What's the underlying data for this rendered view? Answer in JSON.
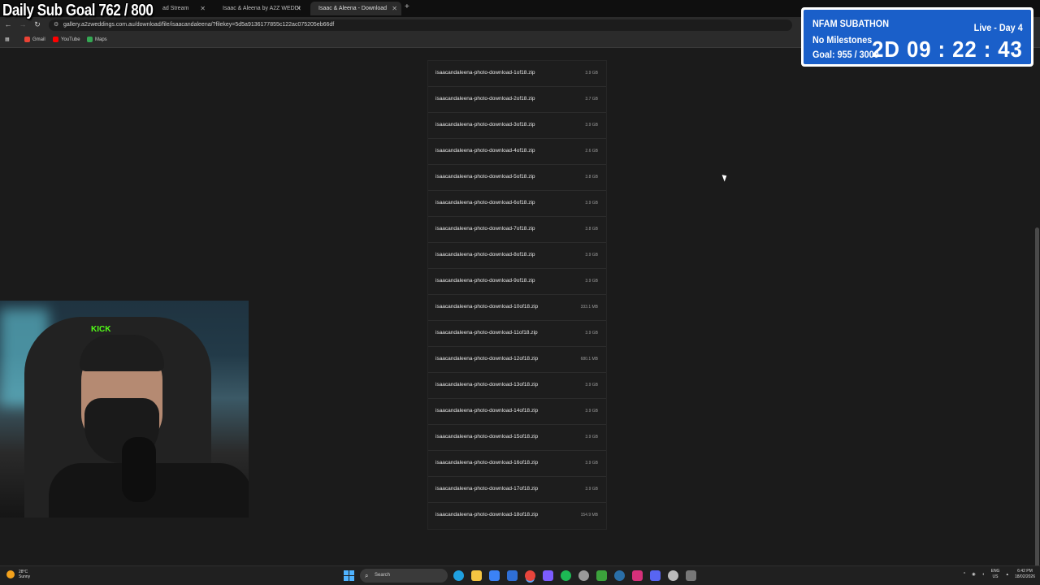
{
  "overlay": {
    "sub_goal": "Daily Sub Goal  762 / 800",
    "subathon_title": "NFAM SUBATHON",
    "subathon_live": "Live - Day 4",
    "subathon_milestones": "No Milestones",
    "subathon_goal": "Goal: 955 / 3000",
    "subathon_timer": "2D  09 : 22 : 43",
    "webcam_logo": "KICK"
  },
  "browser": {
    "tabs": [
      {
        "label": "ad Stream",
        "active": false
      },
      {
        "label": "Isaac & Aleena by A2Z WEDDI",
        "active": false
      },
      {
        "label": "Isaac & Aleena - Download",
        "active": true
      }
    ],
    "url": "gallery.a2zweddings.com.au/download/file/isaacandaleena/?filekey=5d5a9136177855c122ac075205eb66df",
    "bookmarks": [
      {
        "label": "Gmail",
        "icon": "gmail-icon",
        "color": "#ea4335"
      },
      {
        "label": "YouTube",
        "icon": "youtube-icon",
        "color": "#ff0000"
      },
      {
        "label": "Maps",
        "icon": "maps-icon",
        "color": "#34a853"
      }
    ]
  },
  "files": [
    {
      "name": "isaacandaleena-photo-download-1of18.zip",
      "size": "3.9 GB"
    },
    {
      "name": "isaacandaleena-photo-download-2of18.zip",
      "size": "3.7 GB"
    },
    {
      "name": "isaacandaleena-photo-download-3of18.zip",
      "size": "3.9 GB"
    },
    {
      "name": "isaacandaleena-photo-download-4of18.zip",
      "size": "2.6 GB"
    },
    {
      "name": "isaacandaleena-photo-download-5of18.zip",
      "size": "3.8 GB"
    },
    {
      "name": "isaacandaleena-photo-download-6of18.zip",
      "size": "3.9 GB"
    },
    {
      "name": "isaacandaleena-photo-download-7of18.zip",
      "size": "3.8 GB"
    },
    {
      "name": "isaacandaleena-photo-download-8of18.zip",
      "size": "3.9 GB"
    },
    {
      "name": "isaacandaleena-photo-download-9of18.zip",
      "size": "3.9 GB"
    },
    {
      "name": "isaacandaleena-photo-download-10of18.zip",
      "size": "333.1 MB"
    },
    {
      "name": "isaacandaleena-photo-download-11of18.zip",
      "size": "3.9 GB"
    },
    {
      "name": "isaacandaleena-photo-download-12of18.zip",
      "size": "680.1 MB"
    },
    {
      "name": "isaacandaleena-photo-download-13of18.zip",
      "size": "3.9 GB"
    },
    {
      "name": "isaacandaleena-photo-download-14of18.zip",
      "size": "3.9 GB"
    },
    {
      "name": "isaacandaleena-photo-download-15of18.zip",
      "size": "3.9 GB"
    },
    {
      "name": "isaacandaleena-photo-download-16of18.zip",
      "size": "3.9 GB"
    },
    {
      "name": "isaacandaleena-photo-download-17of18.zip",
      "size": "3.9 GB"
    },
    {
      "name": "isaacandaleena-photo-download-18of18.zip",
      "size": "154.9 MB"
    }
  ],
  "taskbar": {
    "temperature": "28°C",
    "weather": "Sunny",
    "search_placeholder": "Search",
    "lang_top": "ENG",
    "lang_bottom": "US",
    "time": "6:42 PM",
    "date": "18/02/2026",
    "app_icons": [
      {
        "name": "edge-icon",
        "color": "#1fa0e0"
      },
      {
        "name": "file-explorer-icon",
        "color": "#f5c542"
      },
      {
        "name": "store-icon",
        "color": "#3b82f6"
      },
      {
        "name": "mail-icon",
        "color": "#2f6fd6"
      },
      {
        "name": "chrome-icon",
        "color": "#e8453c"
      },
      {
        "name": "app-icon",
        "color": "#7c5cff"
      },
      {
        "name": "spotify-icon",
        "color": "#1db954"
      },
      {
        "name": "obs-icon",
        "color": "#9a9a9a"
      },
      {
        "name": "xbox-icon",
        "color": "#3ca23c"
      },
      {
        "name": "steam-icon",
        "color": "#2a6fa8"
      },
      {
        "name": "instagram-icon",
        "color": "#d6307a"
      },
      {
        "name": "discord-icon",
        "color": "#5865f2"
      },
      {
        "name": "app2-icon",
        "color": "#bbbbbb"
      },
      {
        "name": "snipping-icon",
        "color": "#777777"
      }
    ]
  }
}
